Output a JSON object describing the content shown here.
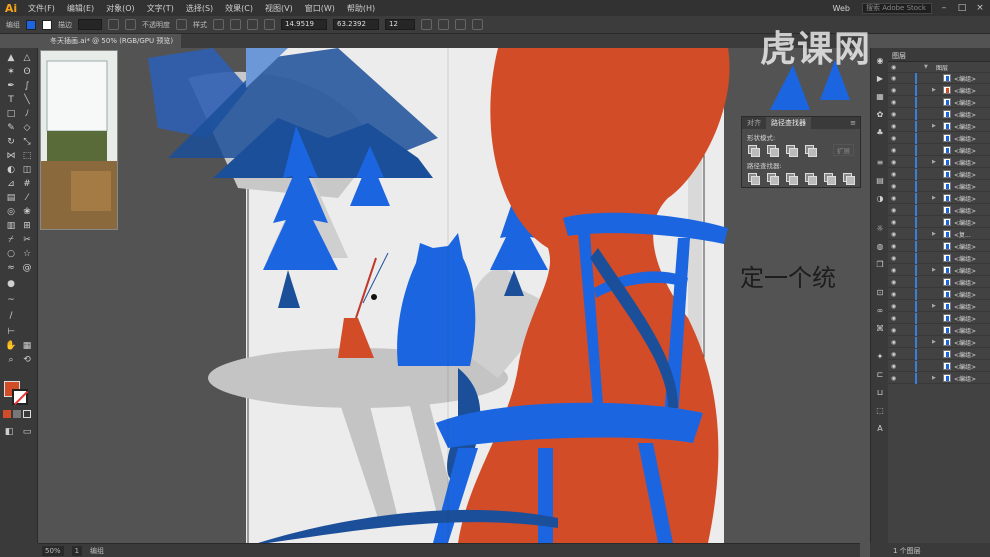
{
  "app": {
    "logo": "Ai"
  },
  "menu": [
    {
      "id": "file",
      "label": "文件(F)"
    },
    {
      "id": "edit",
      "label": "编辑(E)"
    },
    {
      "id": "object",
      "label": "对象(O)"
    },
    {
      "id": "type",
      "label": "文字(T)"
    },
    {
      "id": "select",
      "label": "选择(S)"
    },
    {
      "id": "effect",
      "label": "效果(C)"
    },
    {
      "id": "view",
      "label": "视图(V)"
    },
    {
      "id": "window",
      "label": "窗口(W)"
    },
    {
      "id": "help",
      "label": "帮助(H)"
    }
  ],
  "topright": {
    "workspace": "Web",
    "search_placeholder": "搜索 Adobe Stock"
  },
  "controlbar": {
    "selection_label": "编组",
    "stroke_label": "描边",
    "opacity_label": "不透明度",
    "style_label": "样式",
    "x_value": "14.9519",
    "y_value": "63.2392",
    "w_value": "12"
  },
  "document_tab": {
    "label": "冬天插画.ai* @ 50% (RGB/GPU 预览)"
  },
  "pathfinder": {
    "tabs": [
      "对齐",
      "路径查找器"
    ],
    "active_tab": "路径查找器",
    "shape_modes_label": "形状模式:",
    "pathfinders_label": "路径查找器:",
    "apply_label": "扩展"
  },
  "subtitle": "定一个统",
  "watermark": "虎课网",
  "layers": {
    "header": "图层",
    "top_layer": "图层",
    "item_name": "<编组>",
    "partial_item": "<复...",
    "footer": "1 个图层"
  },
  "status": {
    "zoom": "50%",
    "page": "1",
    "tool": "编组"
  },
  "colors": {
    "accent_orange": "#d24c28",
    "accent_blue": "#1b66e0",
    "dark_blue": "#1b4f9a",
    "illustration_bg": "#ececec"
  },
  "icons": {
    "selection_tool": "arrow-icon",
    "pen_tool": "pen-icon",
    "type_tool": "type-icon",
    "eye": "eye-icon"
  }
}
